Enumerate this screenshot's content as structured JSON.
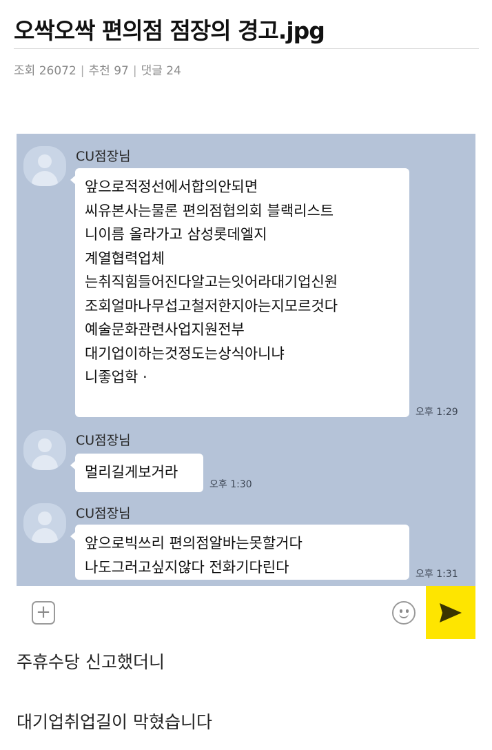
{
  "post": {
    "title": "오싹오싹 편의점 점장의 경고.jpg",
    "meta": {
      "views_label": "조회",
      "views": "26072",
      "recommend_label": "추천",
      "recommend": "97",
      "comments_label": "댓글",
      "comments": "24"
    },
    "captions": [
      "주휴수당 신고했더니",
      "대기업취업길이 막혔습니다"
    ]
  },
  "chat": {
    "messages": [
      {
        "sender": "CU점장님",
        "lines": [
          "앞으로적정선에서합의안되면",
          "씨유본사는물론 편의점협의회 블랙리스트",
          "니이름 올라가고 삼성롯데엘지",
          "계열협력업체",
          "는취직힘들어진다알고는잇어라대기업신원",
          "조회얼마나무섭고철저한지아는지모르것다",
          "예술문화관련사업지원전부",
          "대기업이하는것정도는상식아니냐",
          "니좋업학 ·"
        ],
        "time": "오후 1:29"
      },
      {
        "sender": "CU점장님",
        "lines": [
          "멀리길게보거라"
        ],
        "time": "오후 1:30"
      },
      {
        "sender": "CU점장님",
        "lines": [
          "앞으로빅쓰리 편의점알바는못할거다",
          "나도그러고싶지않다 전화기다린다"
        ],
        "time": "오후 1:31"
      }
    ],
    "input": {
      "plus_icon": "plus-icon",
      "emoji_icon": "emoji-icon",
      "send_icon": "send-icon",
      "send_color": "#fee500",
      "chat_bg_color": "#b5c3d8"
    }
  }
}
